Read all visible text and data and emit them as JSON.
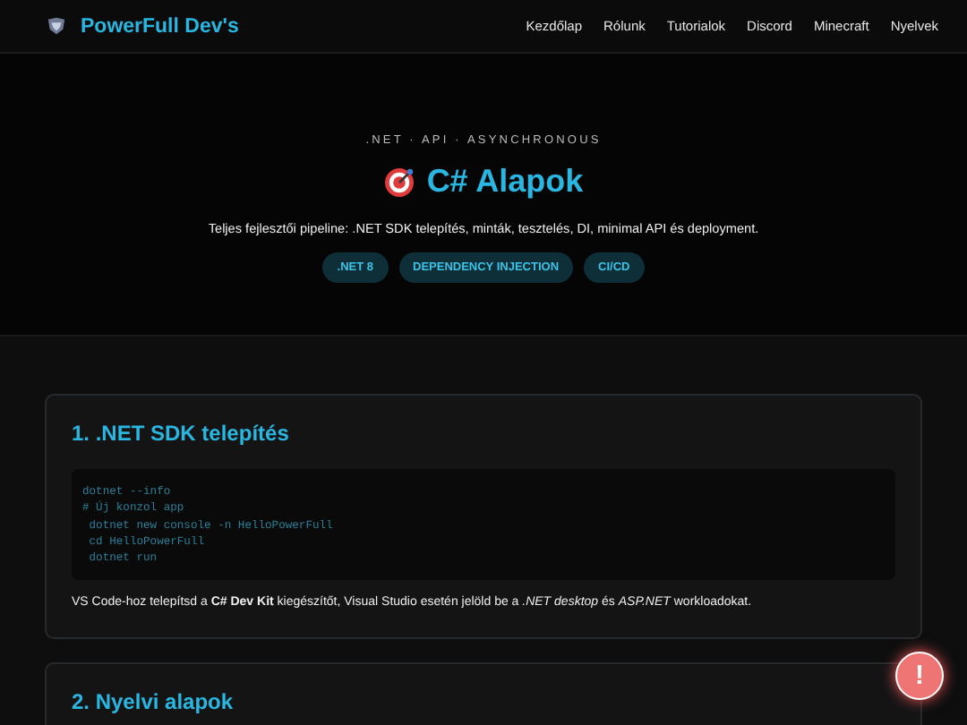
{
  "header": {
    "brand": "PowerFull Dev's",
    "nav": [
      "Kezdőlap",
      "Rólunk",
      "Tutorialok",
      "Discord",
      "Minecraft",
      "Nyelvek"
    ]
  },
  "hero": {
    "eyebrow": ".NET · API · ASYNCHRONOUS",
    "title": "C# Alapok",
    "subtitle": "Teljes fejlesztői pipeline: .NET SDK telepítés, minták, tesztelés, DI, minimal API és deployment.",
    "tags": [
      ".NET 8",
      "DEPENDENCY INJECTION",
      "CI/CD"
    ]
  },
  "sections": [
    {
      "heading": "1. .NET SDK telepítés",
      "code": [
        "dotnet --info",
        "# Új konzol app",
        " dotnet new console -n HelloPowerFull",
        " cd HelloPowerFull",
        " dotnet run"
      ],
      "note": "VS Code-hoz telepítsd a **C# Dev Kit** kiegészítőt, Visual Studio esetén jelöld be a *.NET desktop* és *ASP.NET* workloadokat."
    },
    {
      "heading": "2. Nyelvi alapok"
    }
  ],
  "alert_button": {
    "label": "!"
  }
}
